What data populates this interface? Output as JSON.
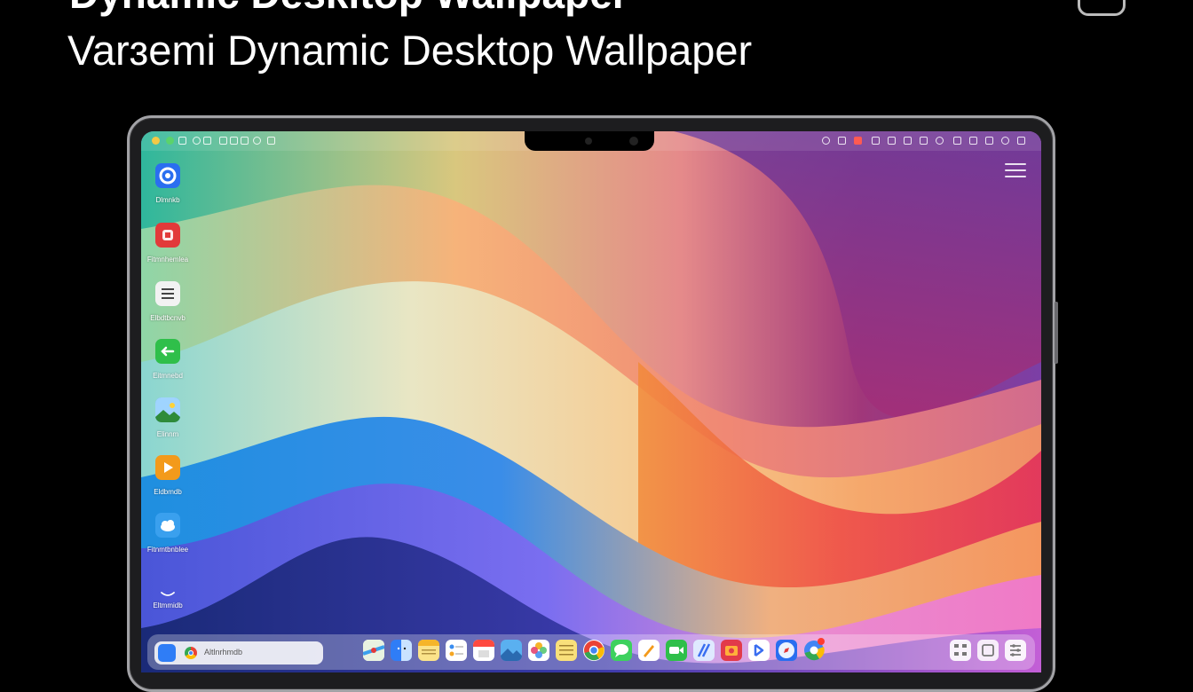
{
  "header": {
    "title_top": "Dynamic Deskltop Wallpaper",
    "title_main": "Varɜemi Dynamic Desktop Wallpaper"
  },
  "desktop_icons": [
    {
      "label": "Dlmnkb",
      "icon": "swirl-app-icon",
      "color": "#2a6ef0"
    },
    {
      "label": "Fitmnhemlea",
      "icon": "red-square-app-icon",
      "color": "#e23a3a"
    },
    {
      "label": "Elbdtbcnvb",
      "icon": "document-list-icon",
      "color": "#f2f2f2"
    },
    {
      "label": "Eitmnebd",
      "icon": "green-arrow-app-icon",
      "color": "#2fbf4a"
    },
    {
      "label": "Elinnm",
      "icon": "photo-landscape-icon",
      "color": "#5aa8f0"
    },
    {
      "label": "Eldbmdb",
      "icon": "orange-play-icon",
      "color": "#f39a1b"
    },
    {
      "label": "Fitnmtbnblee",
      "icon": "cloud-folder-icon",
      "color": "#3aa0ee"
    },
    {
      "label": "Eltmmidb",
      "icon": "chevron-icon",
      "color": "#ffffff"
    }
  ],
  "dock": {
    "search_text": "Altlnrhmdb",
    "apps": [
      "maps-icon",
      "finder-icon",
      "notes-icon",
      "reminders-icon",
      "calendar-icon",
      "preview-icon",
      "photos-icon",
      "stickies-icon",
      "chrome-icon",
      "messages-icon",
      "pages-icon",
      "facetime-icon",
      "xcode-icon",
      "photobooth-icon",
      "mail-icon",
      "safari-icon",
      "chrome-badge-icon",
      "calculator-icon",
      "files-icon",
      "settings-icon"
    ]
  }
}
